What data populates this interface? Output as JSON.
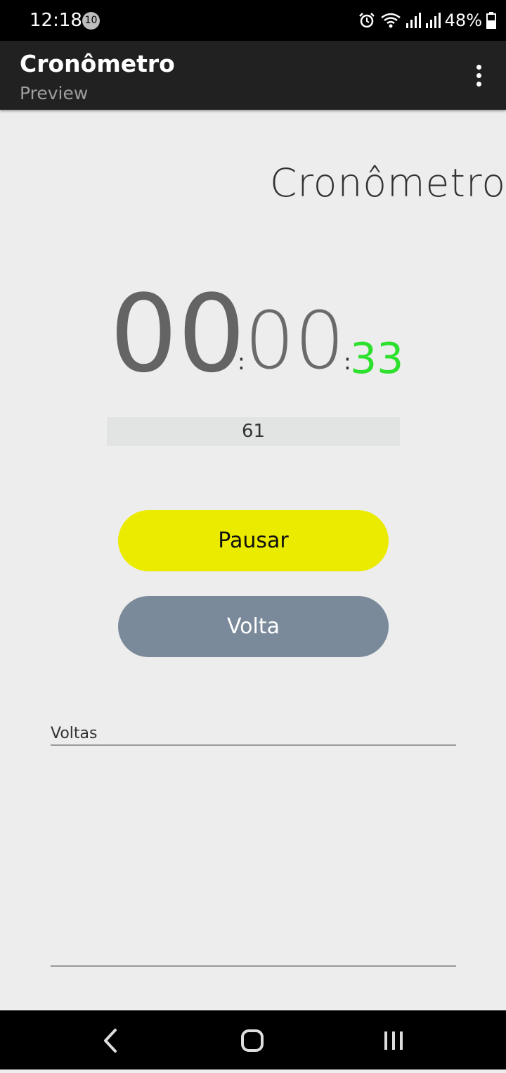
{
  "status_bar": {
    "time": "12:18",
    "notification_count": "10",
    "battery_percent": "48%",
    "icons": [
      "alarm-icon",
      "wifi-icon",
      "signal-icon",
      "signal-icon",
      "battery-icon"
    ]
  },
  "app_bar": {
    "title": "Cronômetro",
    "subtitle": "Preview"
  },
  "main": {
    "heading": "Cronômetro",
    "timer": {
      "hours": "00",
      "separator": ":",
      "minutes": "00",
      "seconds": "33"
    },
    "counter": "61",
    "pause_button": "Pausar",
    "lap_button": "Volta",
    "laps_label": "Voltas"
  },
  "colors": {
    "pause_button": "#ebeb00",
    "lap_button": "#7b8a9a",
    "seconds": "#2ee02e",
    "app_bar": "#212121"
  }
}
